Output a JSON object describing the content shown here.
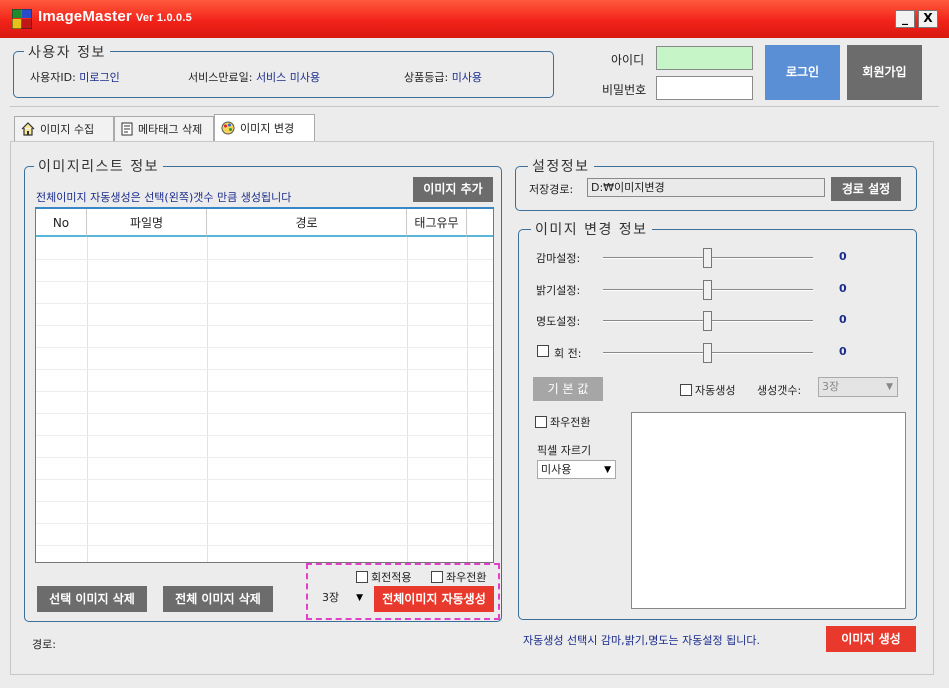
{
  "app": {
    "name": "ImageMaster",
    "version": "Ver 1.0.0.5",
    "minimize": "_",
    "close": "X"
  },
  "user_info": {
    "title": "사용자 정보",
    "id_label": "사용자ID:",
    "id_value": "미로그인",
    "expiry_label": "서비스만료일:",
    "expiry_value": "서비스 미사용",
    "grade_label": "상품등급:",
    "grade_value": "미사용"
  },
  "login": {
    "id_label": "아이디",
    "pw_label": "비밀번호",
    "id_value": "",
    "pw_value": "",
    "login_button": "로그인",
    "signup_button": "회원가입"
  },
  "tabs": [
    {
      "label": "이미지 수집",
      "icon": "home-icon"
    },
    {
      "label": "메타태그 삭제",
      "icon": "document-icon"
    },
    {
      "label": "이미지 변경",
      "icon": "palette-icon",
      "active": true
    }
  ],
  "image_list": {
    "title": "이미지리스트 정보",
    "notice": "전체이미지 자동생성은 선택(왼쪽)갯수 만큼 생성됩니다",
    "add_button": "이미지 추가",
    "columns": [
      "No",
      "파일명",
      "경로",
      "태그유무"
    ],
    "rows": []
  },
  "bottom_left": {
    "rotate_apply": "회전적용",
    "flip_lr": "좌우전환",
    "count_value": "3장",
    "auto_generate_button": "전체이미지 자동생성",
    "delete_selected_button": "선택 이미지 삭제",
    "delete_all_button": "전체 이미지 삭제",
    "path_label": "경로:"
  },
  "settings": {
    "title": "설정정보",
    "save_path_label": "저장경로:",
    "save_path_value": "D:₩이미지변경",
    "path_button": "경로 설정"
  },
  "image_change": {
    "title": "이미지 변경 정보",
    "sliders": [
      {
        "label": "감마설정:",
        "value": "0",
        "level": 0.5
      },
      {
        "label": "밝기설정:",
        "value": "0",
        "level": 0.5
      },
      {
        "label": "명도설정:",
        "value": "0",
        "level": 0.5
      },
      {
        "label": "회 전:",
        "value": "0",
        "level": 0.5,
        "checkbox": true
      }
    ],
    "default_button": "기 본 값",
    "auto_generate_label": "자동생성",
    "count_label": "생성갯수:",
    "count_value": "3장",
    "flip_label": "좌우전환",
    "pixel_crop_label": "픽셀 자르기",
    "pixel_crop_value": "미사용"
  },
  "footer": {
    "notice": "자동생성 선택시 감마,밝기,명도는 자동설정 됩니다.",
    "generate_button": "이미지 생성"
  },
  "colors": {
    "title_red": "#f2231a",
    "login_blue": "#5a8fd6",
    "action_red": "#e8392c",
    "button_gray": "#6c6c6c"
  }
}
